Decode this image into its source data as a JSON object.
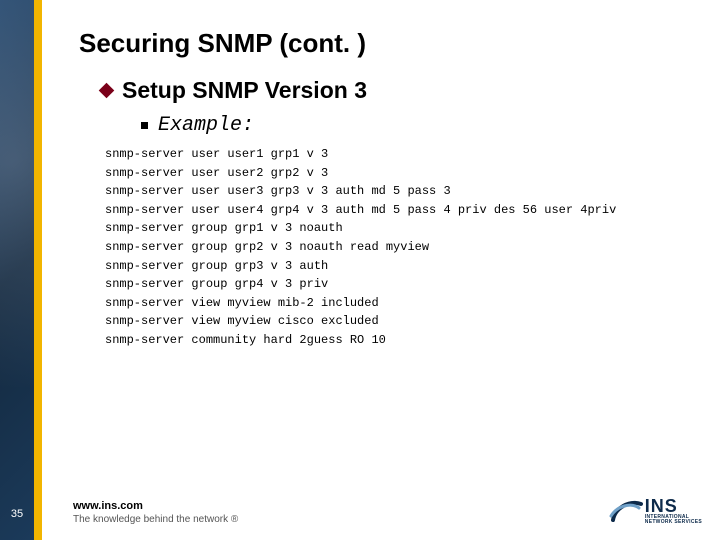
{
  "slide": {
    "title": "Securing SNMP (cont. )",
    "bullet": "Setup SNMP Version 3",
    "sub_bullet": "Example:",
    "code_lines": [
      "snmp-server user user1 grp1 v 3",
      "snmp-server user user2 grp2 v 3",
      "snmp-server user user3 grp3 v 3 auth md 5 pass 3",
      "snmp-server user user4 grp4 v 3 auth md 5 pass 4 priv des 56 user 4priv",
      "snmp-server group grp1 v 3 noauth",
      "snmp-server group grp2 v 3 noauth read myview",
      "snmp-server group grp3 v 3 auth",
      "snmp-server group grp4 v 3 priv",
      "snmp-server view myview mib-2 included",
      "snmp-server view myview cisco excluded",
      "snmp-server community hard 2guess RO 10"
    ]
  },
  "footer": {
    "page": "35",
    "url": "www.ins.com",
    "tagline": "The knowledge behind the network ®"
  },
  "logo": {
    "big": "INS",
    "line1": "INTERNATIONAL",
    "line2": "NETWORK SERVICES"
  }
}
